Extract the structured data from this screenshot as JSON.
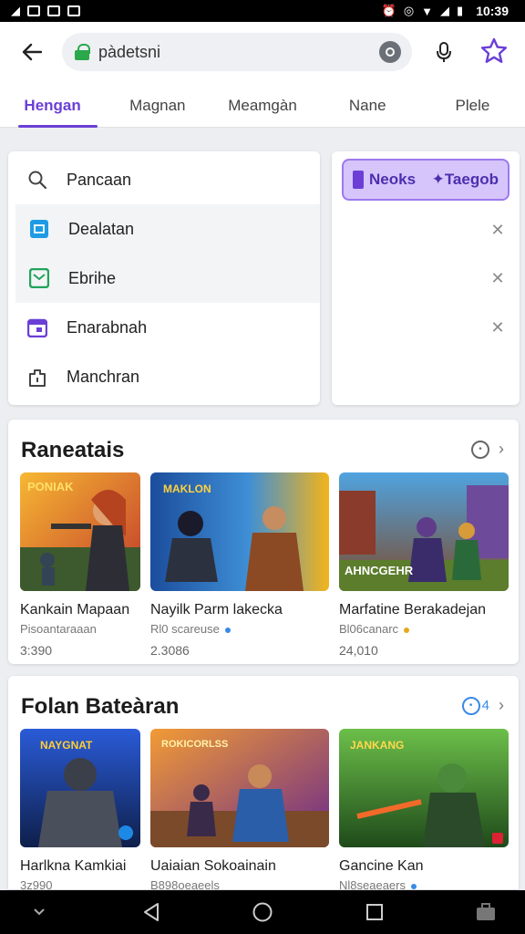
{
  "status": {
    "time": "10:39"
  },
  "search": {
    "value": "pàdetsni"
  },
  "tabs": [
    "Hengan",
    "Magnan",
    "Meamgàn",
    "Nane",
    "Plele"
  ],
  "menu": [
    {
      "label": "Pancaan",
      "icon": "search-icon"
    },
    {
      "label": "Dealatan",
      "icon": "blue-square-icon"
    },
    {
      "label": "Ebrihe",
      "icon": "green-square-icon"
    },
    {
      "label": "Enarabnah",
      "icon": "purple-calendar-icon"
    },
    {
      "label": "Manchran",
      "icon": "bag-icon"
    }
  ],
  "side": {
    "pill_left": "Neoks",
    "pill_right": "Taegob"
  },
  "sections": [
    {
      "title": "Raneatais",
      "games": [
        {
          "title": "Kankain Mapaan",
          "sub": "Pisoantaraaan",
          "num": "3:390",
          "art": "PONIAK"
        },
        {
          "title": "Nayilk  Parm lakecka",
          "sub": "Rl0 scareuse",
          "num": "2.3086",
          "art": "MAKLON"
        },
        {
          "title": "Marfatine Berakadejan",
          "sub": "Bl06canarc",
          "num": "24,010",
          "art": "AHNCGEHR"
        }
      ]
    },
    {
      "title": "Folan Bateàran",
      "games": [
        {
          "title": "Harlkna Kamkiai",
          "sub": "3z990",
          "num": "",
          "art": "NAYGNAT"
        },
        {
          "title": "Uaiaian Sokoainain",
          "sub": "B898oeaeels",
          "num": "",
          "art": "ROKICORLSS"
        },
        {
          "title": "Gancine Kan",
          "sub": "Nl8seaeaers",
          "num": "",
          "art": "JANKANG"
        }
      ]
    }
  ],
  "colors": {
    "accent": "#6b3fd6",
    "pill_bg": "#d6c5fb",
    "lock": "#2aa84a"
  }
}
